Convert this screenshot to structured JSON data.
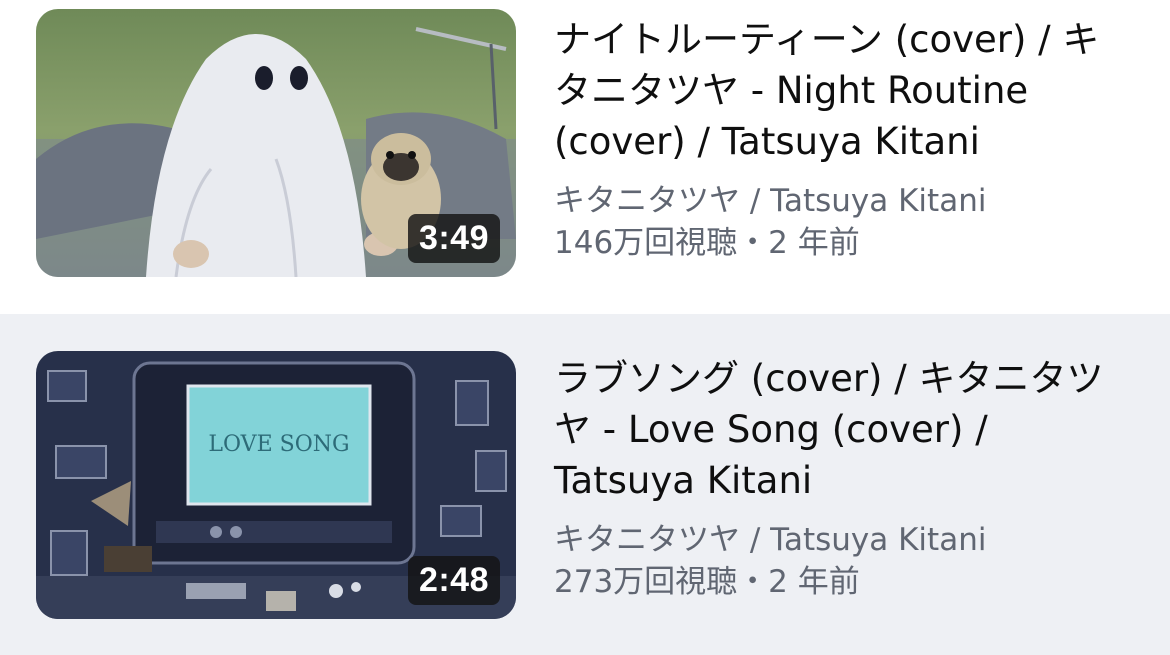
{
  "videos": [
    {
      "title": "ナイトルーティーン (cover) / キタニタツヤ - Night Routine (cover) / Tatsuya Kitani",
      "channel": "キタニタツヤ / Tatsuya Kitani",
      "stats": "146万回視聴・2 年前",
      "duration": "3:49",
      "thumbnail_icon": "ghost-with-pug-thumbnail"
    },
    {
      "title": "ラブソング (cover) / キタニタツヤ - Love Song (cover) / Tatsuya Kitani",
      "channel": "キタニタツヤ / Tatsuya Kitani",
      "stats": "273万回視聴・2 年前",
      "duration": "2:48",
      "thumbnail_icon": "retro-tv-room-thumbnail",
      "thumbnail_screen_text": "LOVE SONG"
    }
  ],
  "colors": {
    "title": "#0f0f0f",
    "meta": "#606672",
    "selected_row_bg": "#eef0f4",
    "duration_bg": "#141414"
  }
}
